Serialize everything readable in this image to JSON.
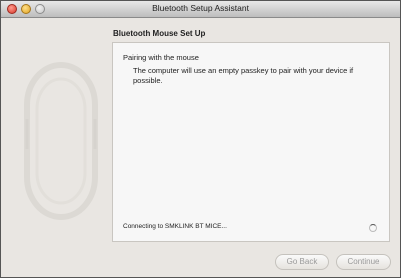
{
  "window": {
    "title": "Bluetooth Setup Assistant"
  },
  "header": {
    "title": "Bluetooth Mouse Set Up"
  },
  "panel": {
    "heading": "Pairing with the mouse",
    "body": "The computer will use an empty passkey to pair with your device if possible.",
    "status": "Connecting to SMKLINK BT MICE..."
  },
  "buttons": {
    "go_back": "Go Back",
    "continue": "Continue"
  },
  "icons": {
    "titlebar": [
      "close-icon",
      "minimize-icon",
      "zoom-icon"
    ],
    "illustration": "mouse-icon",
    "progress": "spinner-icon"
  },
  "colors": {
    "close": "#d8372a",
    "minimize": "#e0a221",
    "zoom": "#c6c6c6",
    "window_bg": "#e9e6e2"
  }
}
